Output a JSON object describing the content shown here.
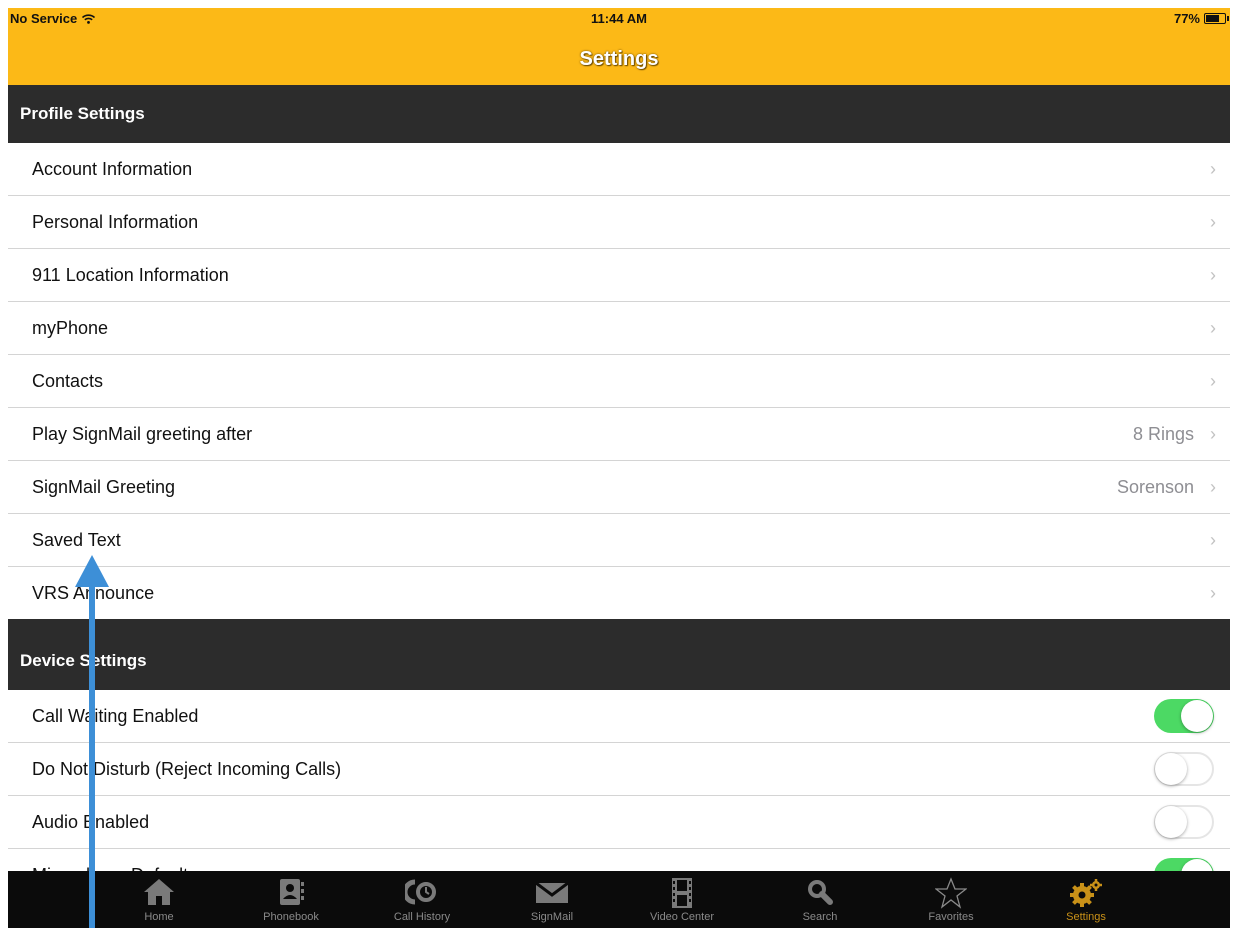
{
  "status_bar": {
    "carrier": "No Service",
    "time": "11:44 AM",
    "battery_percent": "77%",
    "battery_level": 0.77
  },
  "nav": {
    "title": "Settings"
  },
  "profile_section": {
    "header": "Profile Settings",
    "rows": [
      {
        "label": "Account Information",
        "detail": "",
        "chevron": "›"
      },
      {
        "label": "Personal Information",
        "detail": "",
        "chevron": "›"
      },
      {
        "label": "911 Location Information",
        "detail": "",
        "chevron": "›"
      },
      {
        "label": "myPhone",
        "detail": "",
        "chevron": "›"
      },
      {
        "label": "Contacts",
        "detail": "",
        "chevron": "›"
      },
      {
        "label": "Play SignMail greeting after",
        "detail": "8 Rings",
        "chevron": "›"
      },
      {
        "label": "SignMail Greeting",
        "detail": "Sorenson",
        "chevron": "›"
      },
      {
        "label": "Saved Text",
        "detail": "",
        "chevron": "›"
      },
      {
        "label": "VRS Announce",
        "detail": "",
        "chevron": "›"
      }
    ]
  },
  "device_section": {
    "header": "Device Settings",
    "rows": [
      {
        "label": "Call Waiting Enabled",
        "toggle": true
      },
      {
        "label": "Do Not Disturb (Reject Incoming Calls)",
        "toggle": false
      },
      {
        "label": "Audio Enabled",
        "toggle": false
      },
      {
        "label": "Microphone Default",
        "toggle": true
      }
    ]
  },
  "tabbar": {
    "tabs": [
      {
        "label": "Home",
        "icon": "home-icon"
      },
      {
        "label": "Phonebook",
        "icon": "phonebook-icon"
      },
      {
        "label": "Call History",
        "icon": "call-history-icon"
      },
      {
        "label": "SignMail",
        "icon": "envelope-icon"
      },
      {
        "label": "Video Center",
        "icon": "film-icon"
      },
      {
        "label": "Search",
        "icon": "search-icon"
      },
      {
        "label": "Favorites",
        "icon": "star-icon"
      },
      {
        "label": "Settings",
        "icon": "gear-icon"
      }
    ],
    "active": "Settings"
  },
  "colors": {
    "nav_bar": "#fcb917",
    "section_header": "#2c2c2c",
    "toggle_on": "#4cd964",
    "active_tab": "#c99118",
    "annotation_arrow": "#3d8fd7"
  }
}
